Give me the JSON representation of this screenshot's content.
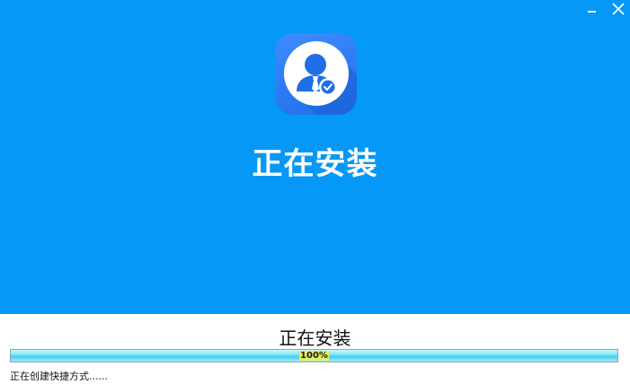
{
  "window": {
    "hero_title": "正在安装",
    "minimize_symbol": "",
    "close_symbol": ""
  },
  "icons": {
    "app": "user-check-icon",
    "minimize": "minimize-icon",
    "close": "close-icon"
  },
  "colors": {
    "hero_background": "#0598f7",
    "icon_background": "#2f7ef5",
    "progress_fill": "#7be3f7"
  },
  "install": {
    "status_title": "正在安装",
    "progress_percent": 100,
    "progress_text": "100%",
    "detail_text": "正在创建快捷方式......"
  }
}
